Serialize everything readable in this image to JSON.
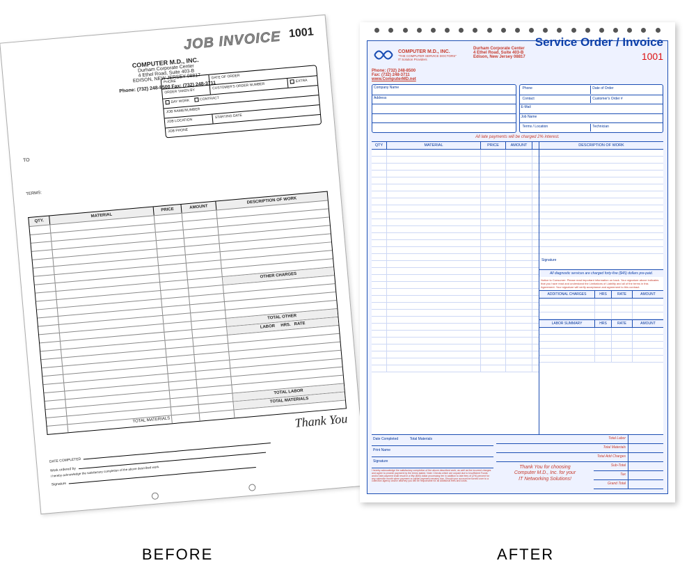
{
  "labels": {
    "before": "BEFORE",
    "after": "AFTER"
  },
  "before": {
    "title": "JOB INVOICE",
    "number": "1001",
    "company": {
      "name": "COMPUTER M.D., INC.",
      "line1": "Durham Corporate Center",
      "line2": "4 Ethel Road, Suite 403-B",
      "line3": "EDISON, NEW JERSEY 08817"
    },
    "phones": "Phone: (732) 248-8500    Fax: (732) 248-3711",
    "box": {
      "phone": "PHONE",
      "date_of_order": "DATE OF ORDER",
      "order_taken_by": "ORDER TAKEN BY",
      "customers_order_number": "CUSTOMER'S ORDER NUMBER",
      "extra": "EXTRA",
      "day_work": "DAY WORK",
      "contract": "CONTRACT",
      "job_name_number": "JOB NAME/NUMBER",
      "job_location": "JOB LOCATION",
      "starting_date": "STARTING DATE",
      "job_phone": "JOB PHONE"
    },
    "to": "TO",
    "terms": "TERMS:",
    "cols": {
      "qty": "QTY.",
      "material": "MATERIAL",
      "price": "PRICE",
      "amount": "AMOUNT",
      "desc": "DESCRIPTION OF WORK"
    },
    "sections": {
      "other_charges": "OTHER CHARGES",
      "total_other": "TOTAL OTHER",
      "labor": "LABOR",
      "hrs": "HRS.",
      "rate": "RATE",
      "total_labor": "TOTAL LABOR",
      "total_materials_upper": "TOTAL MATERIALS",
      "total_materials_lower": "TOTAL MATERIALS"
    },
    "footer": {
      "date_completed": "DATE COMPLETED",
      "work_ordered_by": "Work ordered by",
      "signature": "Signature",
      "ack": "I hereby acknowledge the satisfactory completion of the above described work."
    },
    "thank_you": "Thank You"
  },
  "after": {
    "punch_holes": 21,
    "title": "Service Order / Invoice",
    "number": "1001",
    "company": {
      "name": "COMPUTER M.D., INC.",
      "tagline": "\"THE COMPUTER SERVICE DOCTORS\"",
      "sub": "IT Solution Providers",
      "line1": "Durham Corporate Center",
      "line2": "4 Ethel Road, Suite 403-B",
      "line3": "Edison, New Jersey 08817",
      "phone": "Phone: (732) 248-8500",
      "fax": "Fax: (732) 248-3711",
      "web": "www.ComputerMD.net"
    },
    "left_box": {
      "company_name": "Company Name",
      "address": "Address"
    },
    "right_box": {
      "phone": "Phone",
      "date_of_order": "Date of Order",
      "contact": "Contact",
      "customers_order": "Customer's Order #",
      "email": "E-Mail",
      "job_name": "Job Name",
      "terms_location": "Terms / Location",
      "technician": "Technician"
    },
    "late_notice": "All late payments will be charged 2% interest.",
    "cols": {
      "qty": "QTY",
      "material": "MATERIAL",
      "price": "PRICE",
      "amount": "AMOUNT",
      "desc": "DESCRIPTION OF WORK"
    },
    "signature": "Signature",
    "diag_notice": "All diagnostic services are charged forty-five ($45) dollars pre-paid.",
    "consumer_notice": "Notice to Consumer: Please read important information on back. Your signature above indicates that you have read and understand the Limitations of Liability and all of the terms in this Agreement. Your signature will verify acceptance and agreement to this contract.",
    "additional_charges": "ADDITIONAL CHARGES",
    "labor_summary": "LABOR SUMMARY",
    "hrs": "HRS",
    "rate": "RATE",
    "amt": "AMOUNT",
    "left_foot": {
      "date_completed": "Date Completed",
      "total_materials": "Total Materials",
      "print_name": "Print Name",
      "signature": "Signature",
      "legal": "I hereby acknowledge the satisfactory completion of the above described work, as well as the incurred charges and agree to provide payment by the terms stated. Note: Checks which are unpaid due to Insufficient Funds and/or late payment shall result in a fifty ($50) dollar processing fee in addition to late fees of (2%) percent for any calendar month when payment or partial payment remains due. Should your account be turned over to a collection agency and/or attorney you will be responsible for all additional fees and costs."
    },
    "thanks": {
      "l1": "Thank You for choosing",
      "l2": "Computer M.D., Inc. for your",
      "l3": "IT Networking Solutions!"
    },
    "totals": {
      "total_labor": "Total Labor",
      "total_materials": "Total Materials",
      "total_add_charges": "Total Add Charges",
      "sub_total": "Sub-Total",
      "tax": "Tax",
      "grand_total": "Grand Total"
    }
  }
}
